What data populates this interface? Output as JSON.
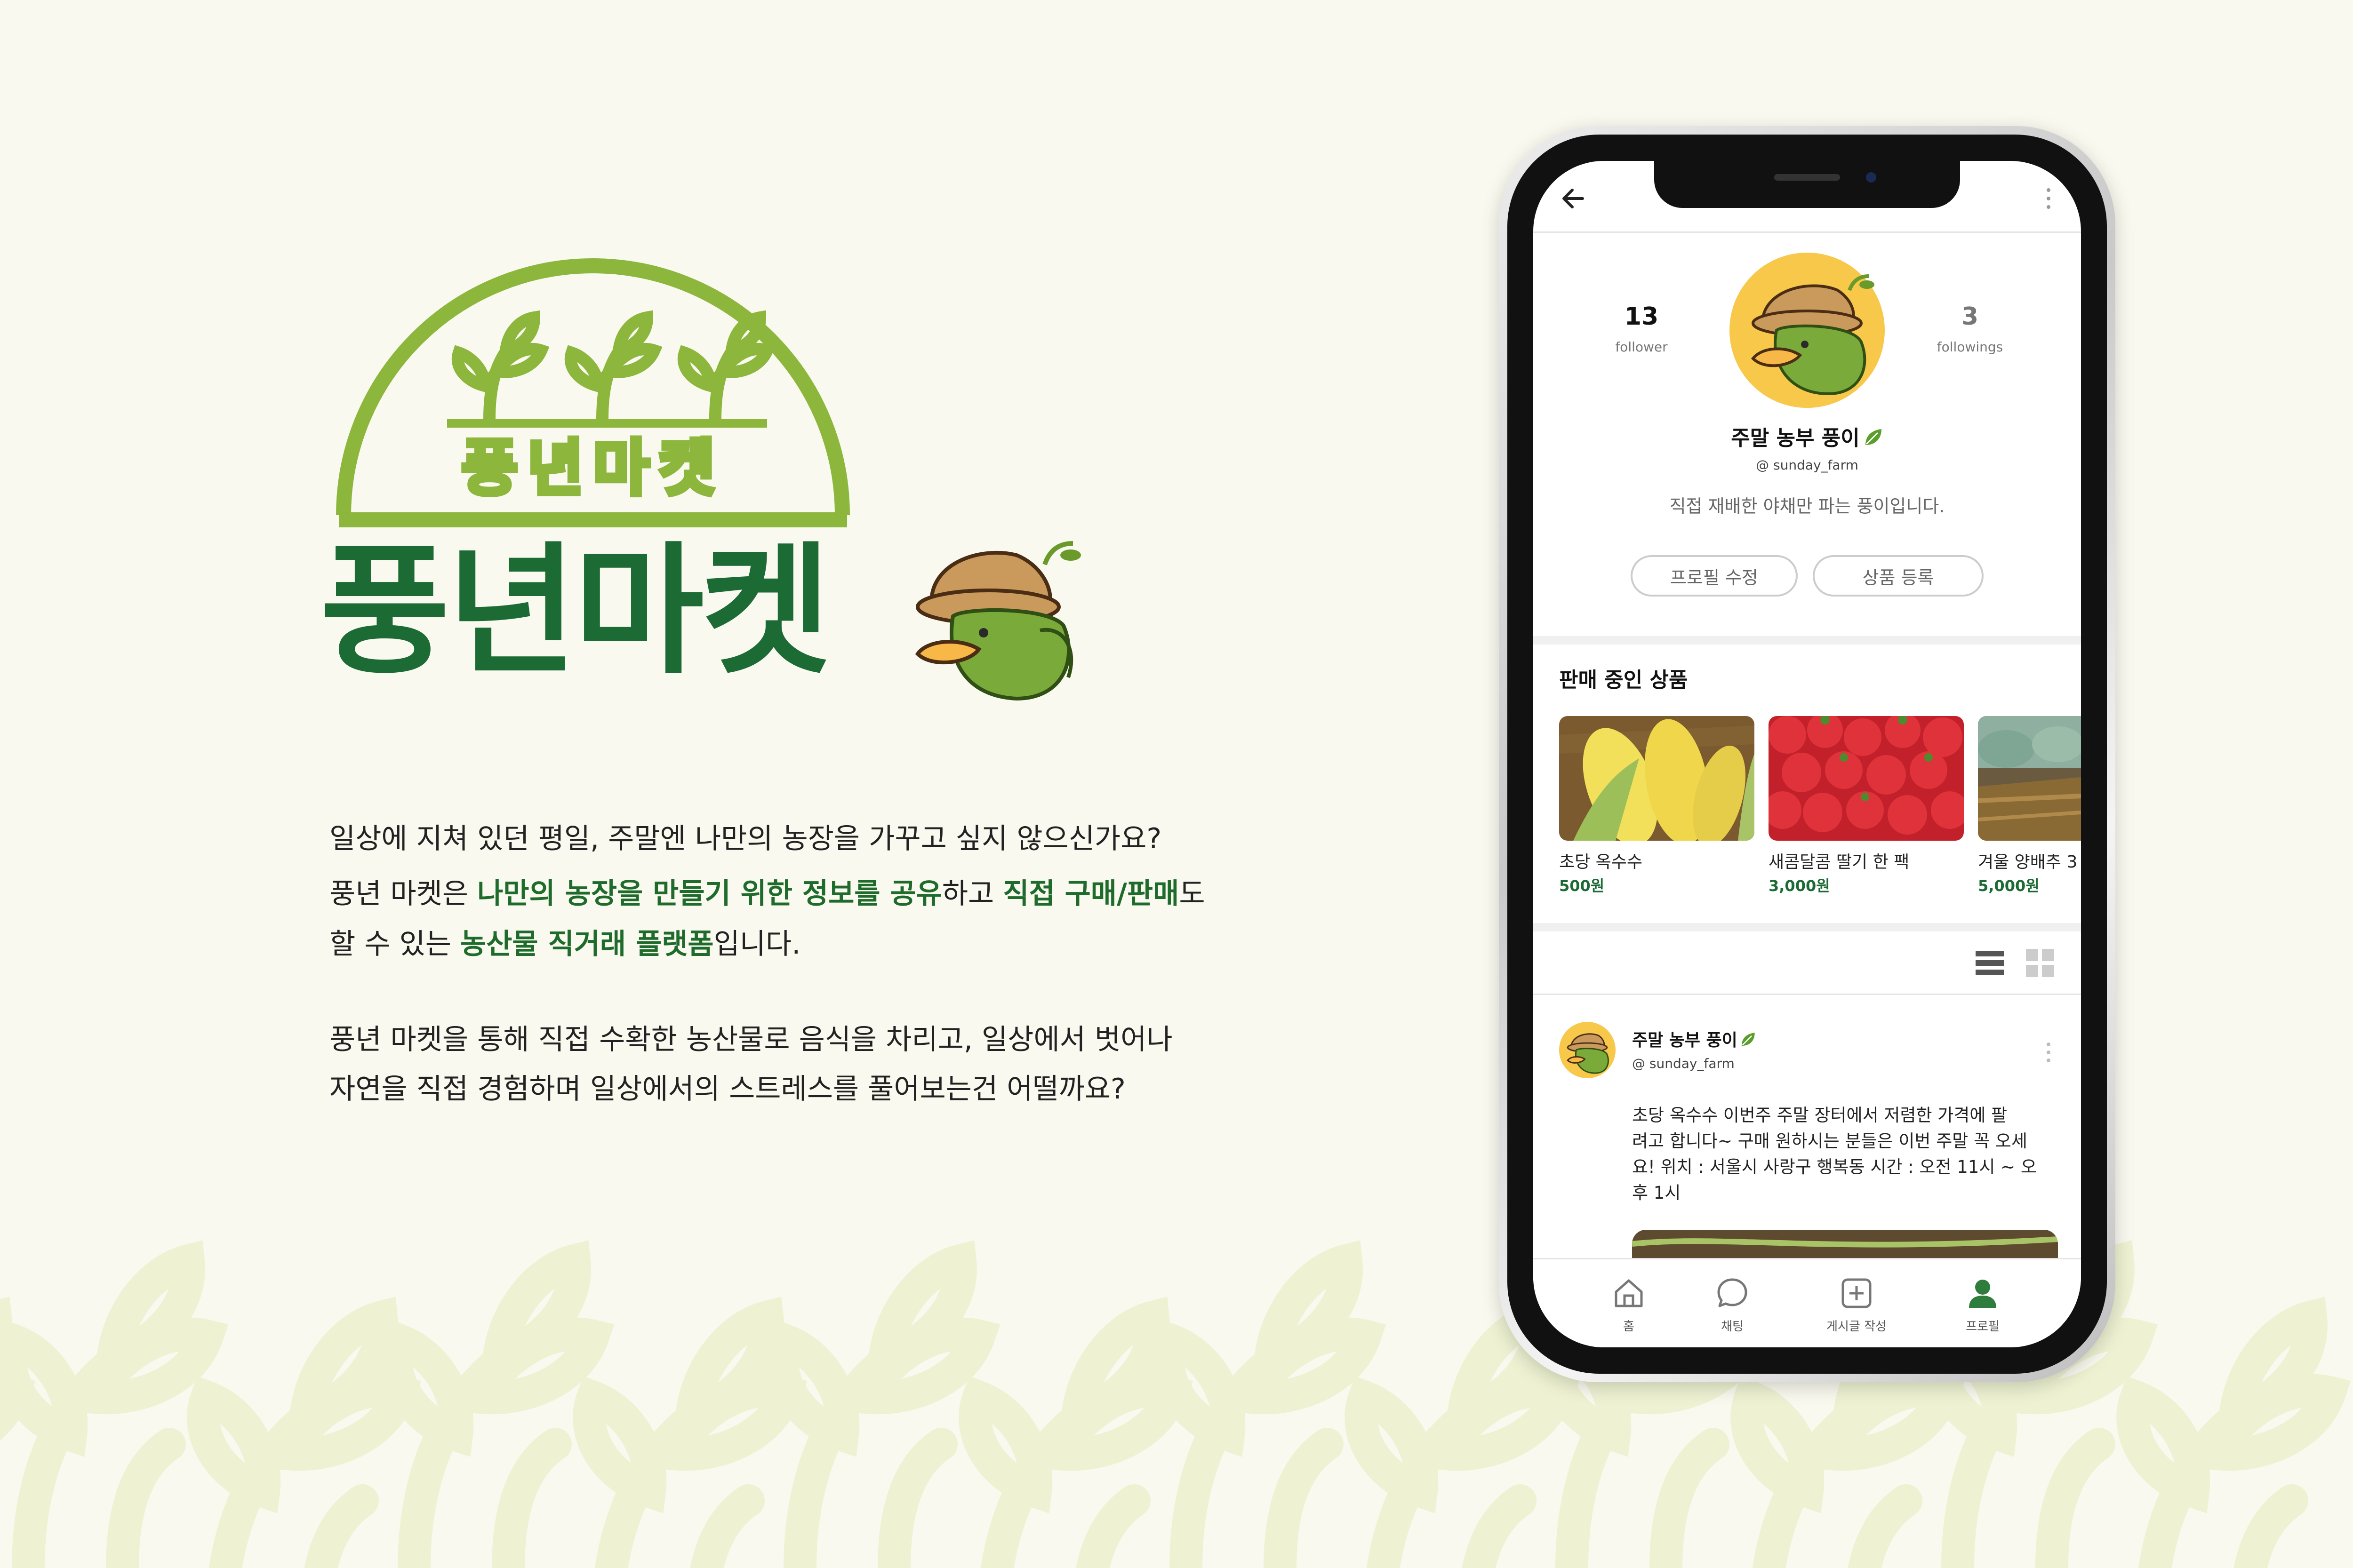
{
  "brand": {
    "name": "풍년마켓",
    "emblem_text": "풍년마켓"
  },
  "description": {
    "line1": "일상에 지쳐 있던 평일, 주말엔 나만의 농장을 가꾸고 싶지 않으신가요?",
    "line2_a": "풍년 마켓은 ",
    "line2_b": "나만의 농장을 만들기 위한 정보를 공유",
    "line2_c": "하고 ",
    "line2_d": "직접 구매/판매",
    "line2_e": "도",
    "line3_a": "할 수 있는 ",
    "line3_b": "농산물 직거래 플랫폼",
    "line3_c": "입니다.",
    "line4": "풍년 마켓을 통해 직접 수확한 농산물로 음식을 차리고, 일상에서 벗어나",
    "line5": "자연을 직접 경험하며 일상에서의 스트레스를 풀어보는건 어떨까요?"
  },
  "colors": {
    "brand_dark": "#1d6b34",
    "brand_light": "#8cb63c",
    "accent_mascot": "#f7c84a",
    "pattern": "#eef2d2"
  },
  "profile": {
    "follower_count": "13",
    "follower_label": "follower",
    "following_count": "3",
    "following_label": "followings",
    "name": "주말 농부 풍이",
    "handle": "@ sunday_farm",
    "intro": "직접 재배한 야채만 파는 풍이입니다.",
    "edit_button": "프로필 수정",
    "register_button": "상품 등록"
  },
  "products": {
    "section_title": "판매 중인 상품",
    "items": [
      {
        "name": "초당 옥수수",
        "price": "500원",
        "icon": "corn-photo"
      },
      {
        "name": "새콤달콤 딸기 한 팩",
        "price": "3,000원",
        "icon": "strawberry-photo"
      },
      {
        "name": "겨울 양배추 3",
        "price": "5,000원",
        "icon": "cabbage-photo"
      }
    ]
  },
  "post": {
    "author_name": "주말 농부 풍이",
    "author_handle": "@ sunday_farm",
    "text_line1": "초당 옥수수 이번주 주말 장터에서 저렴한 가격에 팔",
    "text_line2": "려고 합니다~ 구매 원하시는 분들은 이번 주말 꼭 오세",
    "text_line3": "요! 위치 : 서울시 사랑구 행복동 시간 : 오전 11시 ~ 오",
    "text_line4": "후 1시"
  },
  "tabbar": {
    "home": "홈",
    "chat": "채팅",
    "write": "게시글 작성",
    "profile": "프로필"
  }
}
